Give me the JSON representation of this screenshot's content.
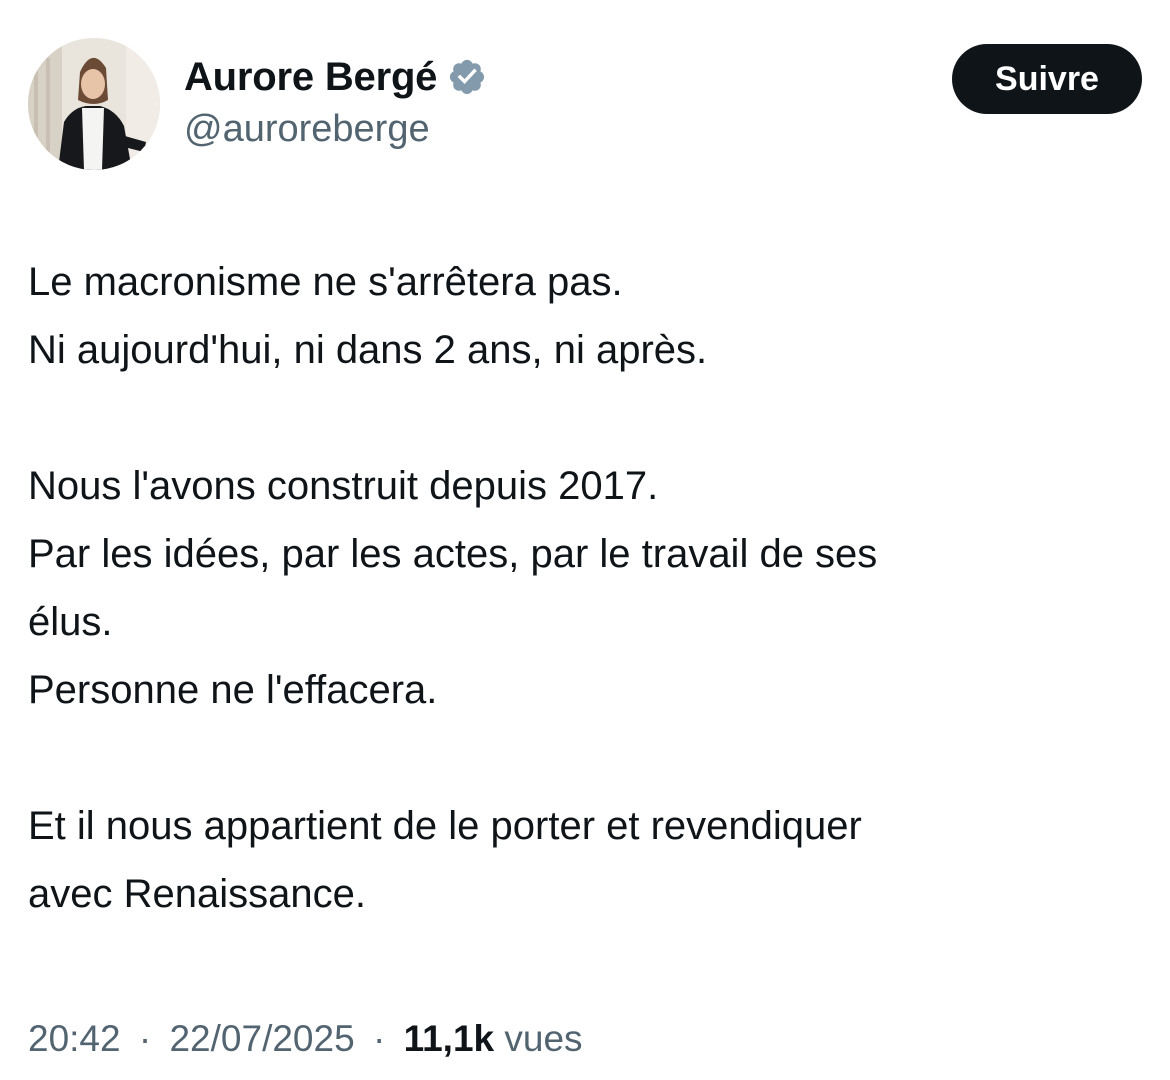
{
  "author": {
    "display_name": "Aurore Bergé",
    "handle": "@auroreberge",
    "verified_icon": "verified-badge-icon",
    "verified_color": "#829aab"
  },
  "follow_button": {
    "label": "Suivre",
    "background": "#0f1419"
  },
  "tweet": {
    "paragraphs": [
      {
        "lines": [
          "Le macronisme ne s'arrêtera pas.",
          "Ni aujourd'hui, ni dans 2 ans, ni après."
        ]
      },
      {
        "lines": [
          "Nous l'avons construit depuis 2017.",
          "Par les idées, par les actes, par le travail de ses",
          "élus.",
          "Personne ne l'effacera."
        ]
      },
      {
        "lines": [
          "Et il nous appartient de le porter et revendiquer",
          "avec Renaissance."
        ]
      }
    ]
  },
  "meta": {
    "time": "20:42",
    "separator": "·",
    "date": "22/07/2025",
    "views_count": "11,1k",
    "views_label": "vues"
  },
  "colors": {
    "text_primary": "#0f1419",
    "text_secondary": "#536471"
  }
}
